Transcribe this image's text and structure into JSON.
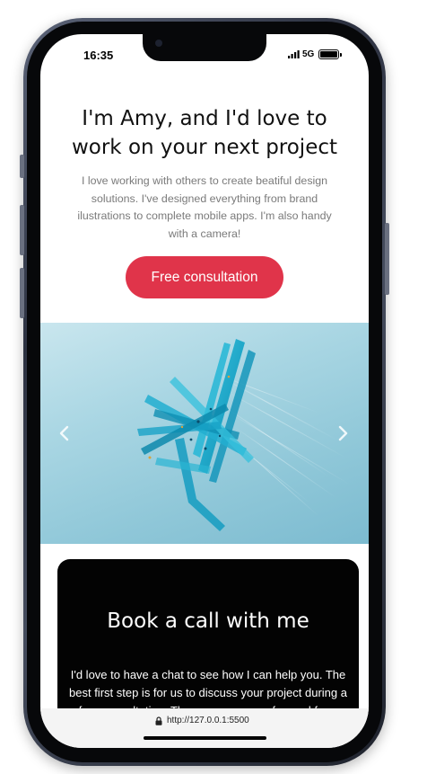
{
  "status_bar": {
    "time": "16:35",
    "network": "5G",
    "signal_icon": "signal-bars-icon",
    "battery_icon": "battery-icon",
    "battery_level": 1.0
  },
  "hero": {
    "title": "I'm Amy, and I'd love to work on your next project",
    "description": "I love working with others to create beatiful design solutions. I've designed everything from brand ilustrations to complete mobile apps. I'm also handy with a camera!",
    "button_label": "Free consultation"
  },
  "carousel": {
    "prev_icon": "chevron-left-icon",
    "next_icon": "chevron-right-icon",
    "image_subject": "blue-abstract-sculpture"
  },
  "book_call": {
    "title": "Book a call with me",
    "text": "I'd love to have a chat to see how I can help you. The best first step is for us to discuss your project during a free consultation. Then we can move forward from there."
  },
  "browser": {
    "lock_icon": "lock-icon",
    "url": "http://127.0.0.1:5500"
  },
  "colors": {
    "accent": "#e0344a",
    "card_bg": "#030303",
    "text_muted": "#7a7a7a"
  }
}
